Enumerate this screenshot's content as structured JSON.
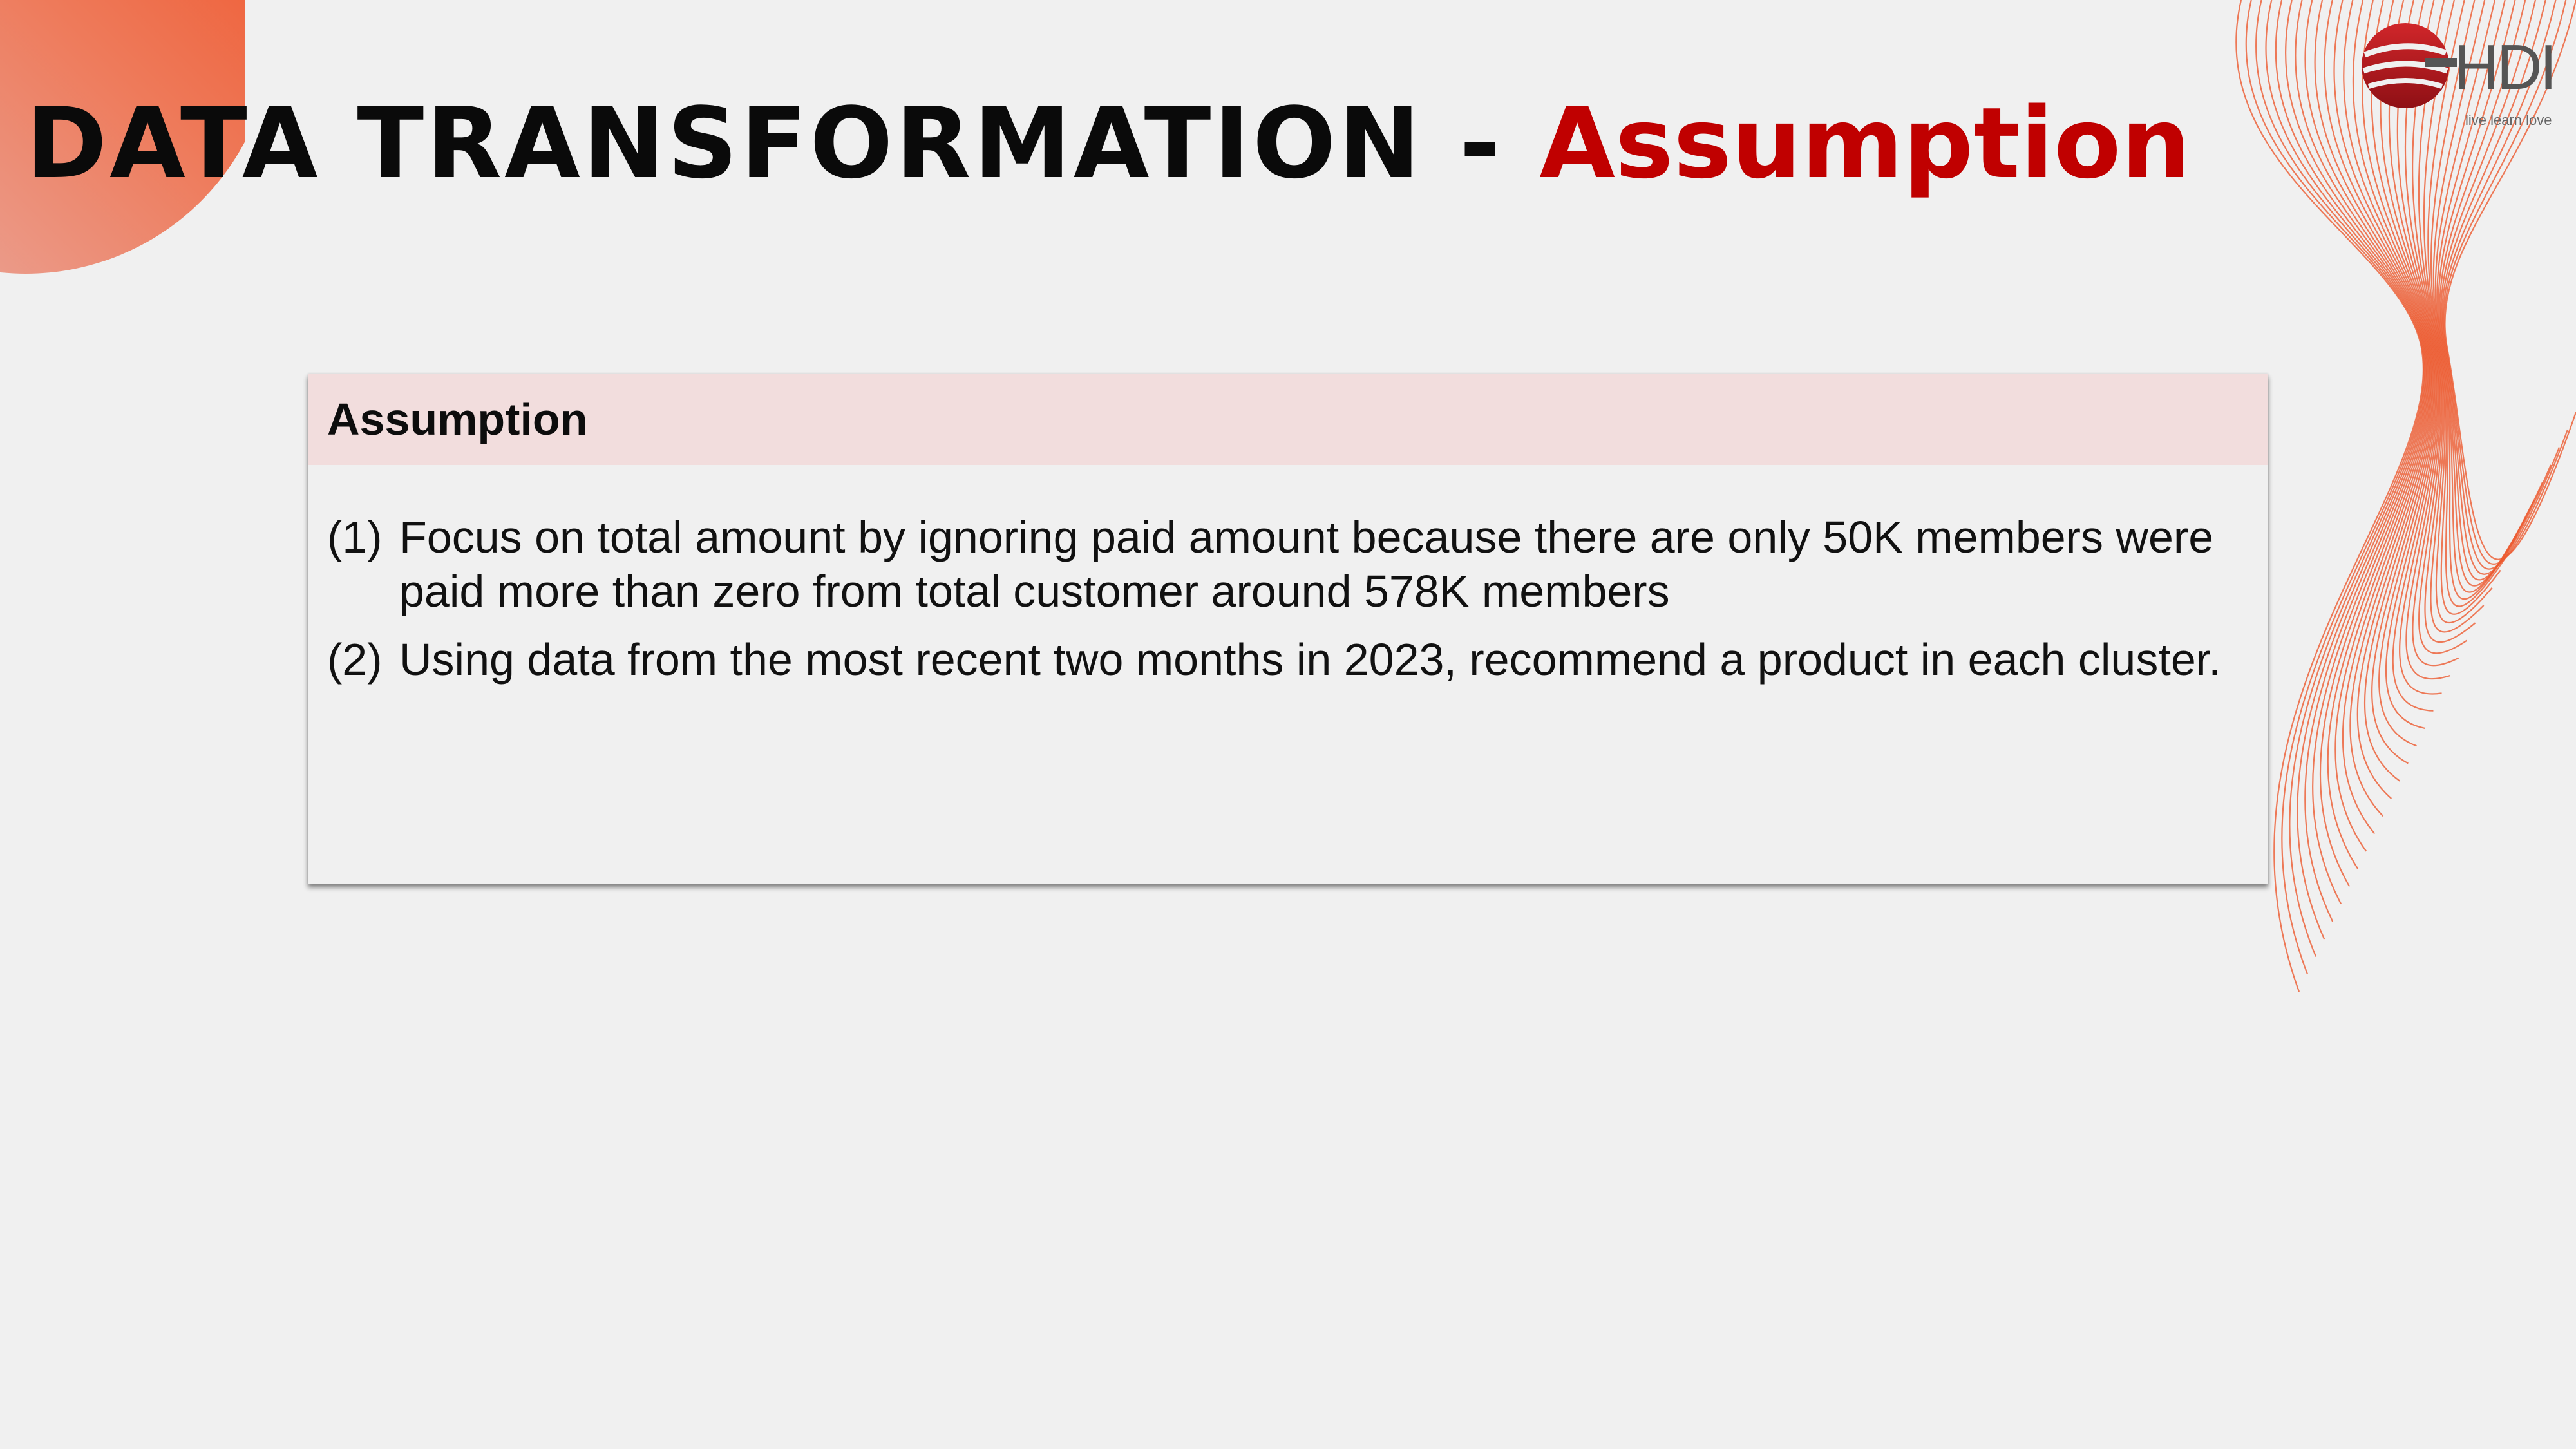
{
  "slide": {
    "title_main": "DATA TRANSFORMATION - ",
    "title_accent": "Assumption"
  },
  "logo": {
    "name": "HDI",
    "tagline": "live learn love"
  },
  "card": {
    "heading": "Assumption",
    "items": [
      {
        "number": "(1)",
        "text": "Focus on total amount by ignoring paid amount because there are only 50K members were paid more than zero from total customer around 578K members"
      },
      {
        "number": "(2)",
        "text": "Using data from the most recent two months in 2023, recommend a product in each cluster."
      }
    ]
  },
  "colors": {
    "accent": "#c00000",
    "header_bg": "#f2dddd",
    "background": "#f0f0f0",
    "decor_orange": "#ec5a30"
  }
}
